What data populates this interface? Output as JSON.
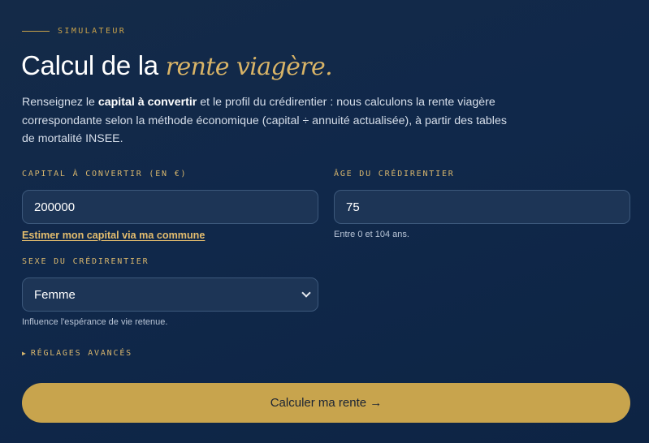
{
  "header": {
    "eyebrow": "SIMULATEUR",
    "title_main": "Calcul de la ",
    "title_accent": "rente viagère.",
    "intro_before": "Renseignez le ",
    "intro_bold": "capital à convertir",
    "intro_after": " et le profil du crédirentier : nous calculons la rente viagère correspondante selon la méthode économique (capital ÷ annuité actualisée), à partir des tables de mortalité INSEE."
  },
  "form": {
    "capital_label": "CAPITAL À CONVERTIR (EN €)",
    "capital_value": "200000",
    "capital_link": "Estimer mon capital via ma commune",
    "age_label": "ÂGE DU CRÉDIRENTIER",
    "age_value": "75",
    "age_hint": "Entre 0 et 104 ans.",
    "sex_label": "SEXE DU CRÉDIRENTIER",
    "sex_value": "Femme",
    "sex_hint": "Influence l'espérance de vie retenue.",
    "advanced_icon": "▶",
    "advanced_label": "RÉGLAGES AVANCÉS",
    "submit_label": "Calculer ma rente →"
  },
  "colors": {
    "accent": "#c8a44d",
    "background": "#10284a",
    "field_bg": "#1d3556"
  }
}
